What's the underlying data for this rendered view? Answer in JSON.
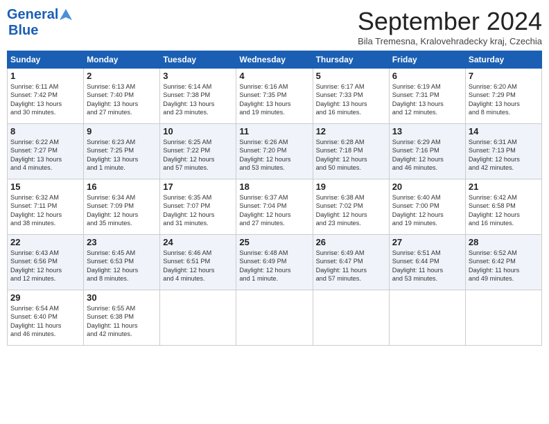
{
  "header": {
    "logo_line1": "General",
    "logo_line2": "Blue",
    "title": "September 2024",
    "location": "Bila Tremesna, Kralovehradecky kraj, Czechia"
  },
  "weekdays": [
    "Sunday",
    "Monday",
    "Tuesday",
    "Wednesday",
    "Thursday",
    "Friday",
    "Saturday"
  ],
  "weeks": [
    [
      {
        "day": "1",
        "lines": [
          "Sunrise: 6:11 AM",
          "Sunset: 7:42 PM",
          "Daylight: 13 hours",
          "and 30 minutes."
        ]
      },
      {
        "day": "2",
        "lines": [
          "Sunrise: 6:13 AM",
          "Sunset: 7:40 PM",
          "Daylight: 13 hours",
          "and 27 minutes."
        ]
      },
      {
        "day": "3",
        "lines": [
          "Sunrise: 6:14 AM",
          "Sunset: 7:38 PM",
          "Daylight: 13 hours",
          "and 23 minutes."
        ]
      },
      {
        "day": "4",
        "lines": [
          "Sunrise: 6:16 AM",
          "Sunset: 7:35 PM",
          "Daylight: 13 hours",
          "and 19 minutes."
        ]
      },
      {
        "day": "5",
        "lines": [
          "Sunrise: 6:17 AM",
          "Sunset: 7:33 PM",
          "Daylight: 13 hours",
          "and 16 minutes."
        ]
      },
      {
        "day": "6",
        "lines": [
          "Sunrise: 6:19 AM",
          "Sunset: 7:31 PM",
          "Daylight: 13 hours",
          "and 12 minutes."
        ]
      },
      {
        "day": "7",
        "lines": [
          "Sunrise: 6:20 AM",
          "Sunset: 7:29 PM",
          "Daylight: 13 hours",
          "and 8 minutes."
        ]
      }
    ],
    [
      {
        "day": "8",
        "lines": [
          "Sunrise: 6:22 AM",
          "Sunset: 7:27 PM",
          "Daylight: 13 hours",
          "and 4 minutes."
        ]
      },
      {
        "day": "9",
        "lines": [
          "Sunrise: 6:23 AM",
          "Sunset: 7:25 PM",
          "Daylight: 13 hours",
          "and 1 minute."
        ]
      },
      {
        "day": "10",
        "lines": [
          "Sunrise: 6:25 AM",
          "Sunset: 7:22 PM",
          "Daylight: 12 hours",
          "and 57 minutes."
        ]
      },
      {
        "day": "11",
        "lines": [
          "Sunrise: 6:26 AM",
          "Sunset: 7:20 PM",
          "Daylight: 12 hours",
          "and 53 minutes."
        ]
      },
      {
        "day": "12",
        "lines": [
          "Sunrise: 6:28 AM",
          "Sunset: 7:18 PM",
          "Daylight: 12 hours",
          "and 50 minutes."
        ]
      },
      {
        "day": "13",
        "lines": [
          "Sunrise: 6:29 AM",
          "Sunset: 7:16 PM",
          "Daylight: 12 hours",
          "and 46 minutes."
        ]
      },
      {
        "day": "14",
        "lines": [
          "Sunrise: 6:31 AM",
          "Sunset: 7:13 PM",
          "Daylight: 12 hours",
          "and 42 minutes."
        ]
      }
    ],
    [
      {
        "day": "15",
        "lines": [
          "Sunrise: 6:32 AM",
          "Sunset: 7:11 PM",
          "Daylight: 12 hours",
          "and 38 minutes."
        ]
      },
      {
        "day": "16",
        "lines": [
          "Sunrise: 6:34 AM",
          "Sunset: 7:09 PM",
          "Daylight: 12 hours",
          "and 35 minutes."
        ]
      },
      {
        "day": "17",
        "lines": [
          "Sunrise: 6:35 AM",
          "Sunset: 7:07 PM",
          "Daylight: 12 hours",
          "and 31 minutes."
        ]
      },
      {
        "day": "18",
        "lines": [
          "Sunrise: 6:37 AM",
          "Sunset: 7:04 PM",
          "Daylight: 12 hours",
          "and 27 minutes."
        ]
      },
      {
        "day": "19",
        "lines": [
          "Sunrise: 6:38 AM",
          "Sunset: 7:02 PM",
          "Daylight: 12 hours",
          "and 23 minutes."
        ]
      },
      {
        "day": "20",
        "lines": [
          "Sunrise: 6:40 AM",
          "Sunset: 7:00 PM",
          "Daylight: 12 hours",
          "and 19 minutes."
        ]
      },
      {
        "day": "21",
        "lines": [
          "Sunrise: 6:42 AM",
          "Sunset: 6:58 PM",
          "Daylight: 12 hours",
          "and 16 minutes."
        ]
      }
    ],
    [
      {
        "day": "22",
        "lines": [
          "Sunrise: 6:43 AM",
          "Sunset: 6:56 PM",
          "Daylight: 12 hours",
          "and 12 minutes."
        ]
      },
      {
        "day": "23",
        "lines": [
          "Sunrise: 6:45 AM",
          "Sunset: 6:53 PM",
          "Daylight: 12 hours",
          "and 8 minutes."
        ]
      },
      {
        "day": "24",
        "lines": [
          "Sunrise: 6:46 AM",
          "Sunset: 6:51 PM",
          "Daylight: 12 hours",
          "and 4 minutes."
        ]
      },
      {
        "day": "25",
        "lines": [
          "Sunrise: 6:48 AM",
          "Sunset: 6:49 PM",
          "Daylight: 12 hours",
          "and 1 minute."
        ]
      },
      {
        "day": "26",
        "lines": [
          "Sunrise: 6:49 AM",
          "Sunset: 6:47 PM",
          "Daylight: 11 hours",
          "and 57 minutes."
        ]
      },
      {
        "day": "27",
        "lines": [
          "Sunrise: 6:51 AM",
          "Sunset: 6:44 PM",
          "Daylight: 11 hours",
          "and 53 minutes."
        ]
      },
      {
        "day": "28",
        "lines": [
          "Sunrise: 6:52 AM",
          "Sunset: 6:42 PM",
          "Daylight: 11 hours",
          "and 49 minutes."
        ]
      }
    ],
    [
      {
        "day": "29",
        "lines": [
          "Sunrise: 6:54 AM",
          "Sunset: 6:40 PM",
          "Daylight: 11 hours",
          "and 46 minutes."
        ]
      },
      {
        "day": "30",
        "lines": [
          "Sunrise: 6:55 AM",
          "Sunset: 6:38 PM",
          "Daylight: 11 hours",
          "and 42 minutes."
        ]
      },
      {
        "day": "",
        "lines": []
      },
      {
        "day": "",
        "lines": []
      },
      {
        "day": "",
        "lines": []
      },
      {
        "day": "",
        "lines": []
      },
      {
        "day": "",
        "lines": []
      }
    ]
  ]
}
